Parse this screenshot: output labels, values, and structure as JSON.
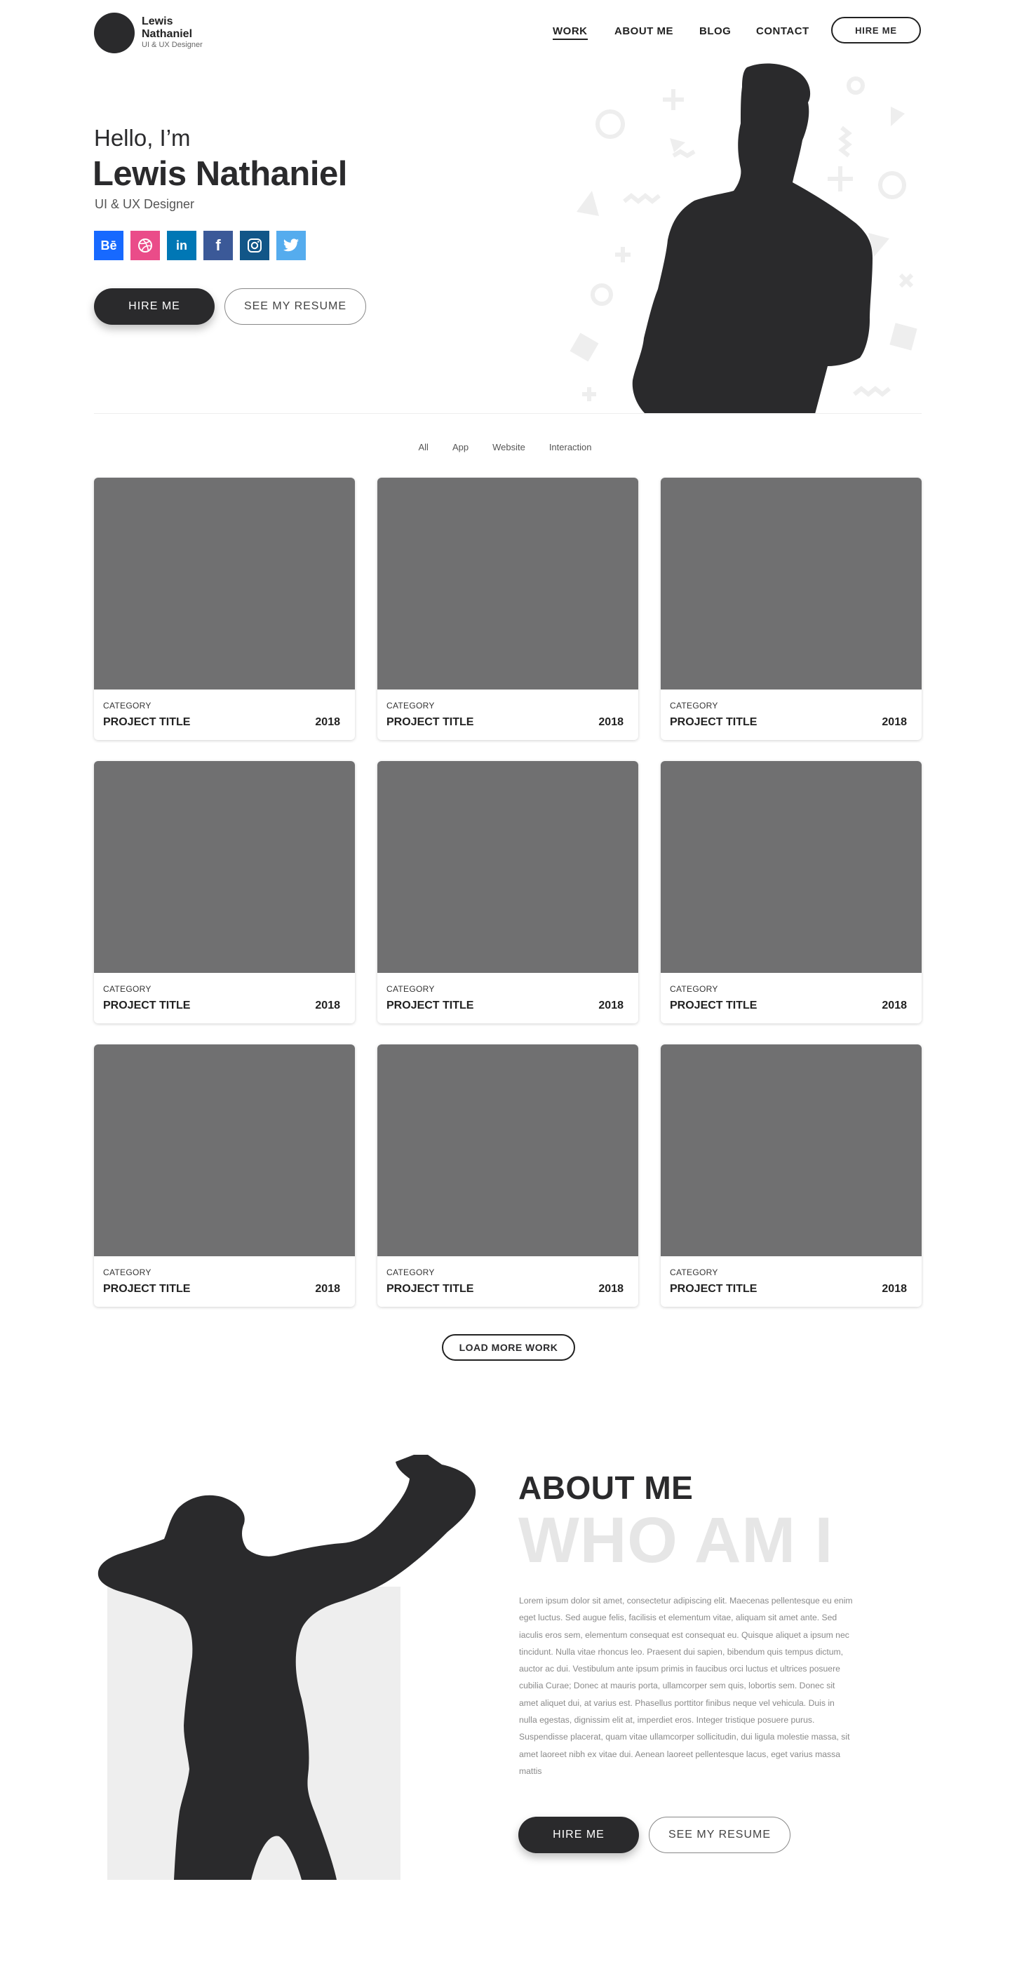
{
  "brand": {
    "name": "Lewis Nathaniel",
    "role": "UI & UX Designer"
  },
  "nav": {
    "work": "WORK",
    "about": "ABOUT ME",
    "blog": "BLOG",
    "contact": "CONTACT",
    "hire": "HIRE ME"
  },
  "hero": {
    "greeting": "Hello, I’m",
    "name": "Lewis Nathaniel",
    "role": "UI & UX Designer",
    "hire_label": "HIRE ME",
    "resume_label": "SEE MY RESUME"
  },
  "socials": [
    {
      "name": "behance",
      "glyph": "Bē",
      "color": "#1769ff"
    },
    {
      "name": "dribbble",
      "glyph": "◍",
      "color": "#ea4c89"
    },
    {
      "name": "linkedin",
      "glyph": "in",
      "color": "#0077b5"
    },
    {
      "name": "facebook",
      "glyph": "f",
      "color": "#3b5998"
    },
    {
      "name": "instagram",
      "glyph": "◎",
      "color": "#125688"
    },
    {
      "name": "twitter",
      "glyph": "🐦",
      "color": "#55acee"
    }
  ],
  "filters": [
    "All",
    "App",
    "Website",
    "Interaction"
  ],
  "projects": [
    {
      "category": "CATEGORY",
      "title": "PROJECT TITLE",
      "year": "2018"
    },
    {
      "category": "CATEGORY",
      "title": "PROJECT TITLE",
      "year": "2018"
    },
    {
      "category": "CATEGORY",
      "title": "PROJECT TITLE",
      "year": "2018"
    },
    {
      "category": "CATEGORY",
      "title": "PROJECT TITLE",
      "year": "2018"
    },
    {
      "category": "CATEGORY",
      "title": "PROJECT TITLE",
      "year": "2018"
    },
    {
      "category": "CATEGORY",
      "title": "PROJECT TITLE",
      "year": "2018"
    },
    {
      "category": "CATEGORY",
      "title": "PROJECT TITLE",
      "year": "2018"
    },
    {
      "category": "CATEGORY",
      "title": "PROJECT TITLE",
      "year": "2018"
    },
    {
      "category": "CATEGORY",
      "title": "PROJECT TITLE",
      "year": "2018"
    }
  ],
  "load_more": "LOAD MORE WORK",
  "about": {
    "heading": "ABOUT ME",
    "ghost": "WHO AM I",
    "text": "Lorem ipsum dolor sit amet, consectetur adipiscing elit. Maecenas pellentesque eu enim eget luctus. Sed augue felis, facilisis et elementum vitae, aliquam sit amet ante. Sed iaculis eros sem, elementum consequat est consequat eu. Quisque aliquet a ipsum nec tincidunt. Nulla vitae rhoncus leo. Praesent dui sapien, bibendum quis tempus dictum, auctor ac dui. Vestibulum ante ipsum primis in faucibus orci luctus et ultrices posuere cubilia Curae; Donec at mauris porta, ullamcorper sem quis, lobortis sem. Donec sit amet aliquet dui, at varius est. Phasellus porttitor finibus neque vel vehicula. Duis in nulla egestas, dignissim elit at, imperdiet eros. Integer tristique posuere purus. Suspendisse placerat, quam vitae ullamcorper sollicitudin, dui ligula molestie massa, sit amet laoreet nibh ex vitae dui. Aenean laoreet pellentesque lacus, eget varius massa mattis",
    "hire_label": "HIRE ME",
    "resume_label": "SEE MY RESUME"
  },
  "colors": {
    "dark": "#2a2a2c",
    "placeholder": "#707071",
    "ghost": "#e6e6e6"
  }
}
